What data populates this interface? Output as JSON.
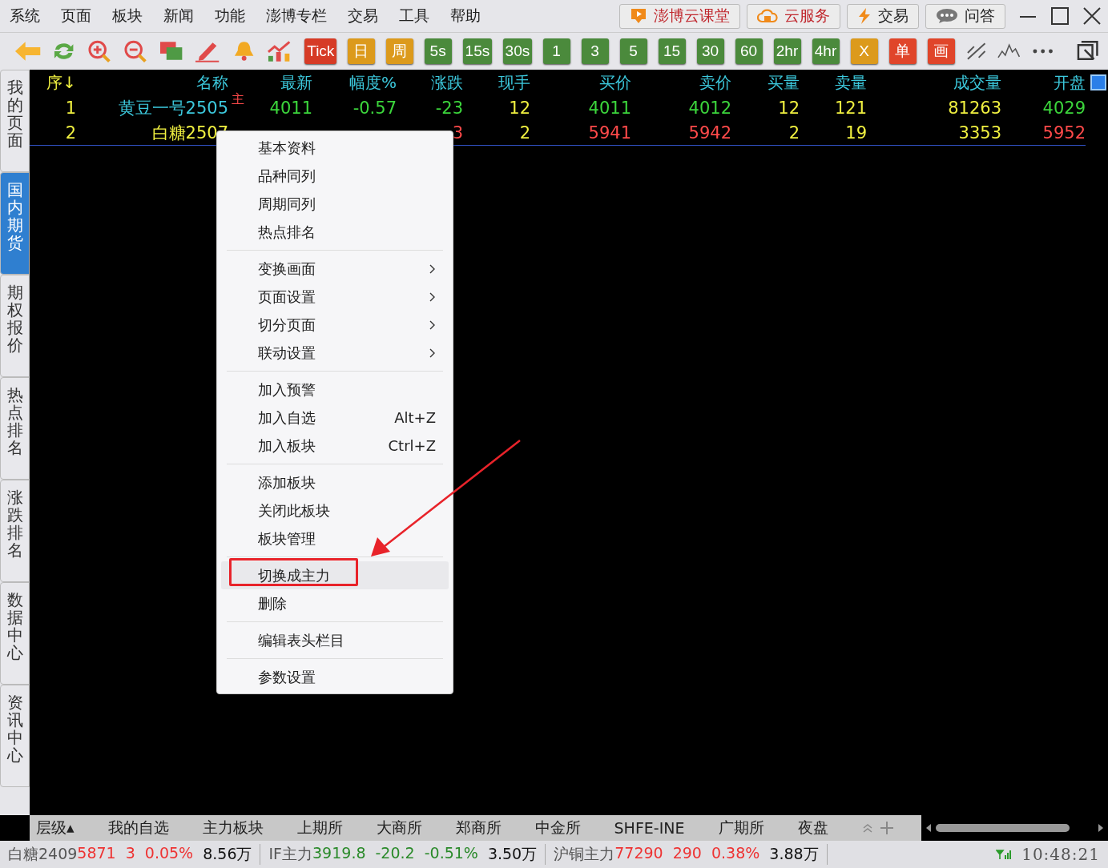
{
  "menubar": [
    "系统",
    "页面",
    "板块",
    "新闻",
    "功能",
    "澎博专栏",
    "交易",
    "工具",
    "帮助"
  ],
  "top_buttons": [
    {
      "label": "澎博云课堂",
      "kind": "course"
    },
    {
      "label": "云服务",
      "kind": "cloud"
    },
    {
      "label": "交易",
      "kind": "trade"
    },
    {
      "label": "问答",
      "kind": "chat"
    }
  ],
  "period_buttons": [
    {
      "label": "Tick",
      "color": "#d63b26"
    },
    {
      "label": "日",
      "color": "#dc9a1c"
    },
    {
      "label": "周",
      "color": "#dc9a1c"
    },
    {
      "label": "5s",
      "color": "#4b8a3c"
    },
    {
      "label": "15s",
      "color": "#4b8a3c"
    },
    {
      "label": "30s",
      "color": "#4b8a3c"
    },
    {
      "label": "1",
      "color": "#4b8a3c"
    },
    {
      "label": "3",
      "color": "#4b8a3c"
    },
    {
      "label": "5",
      "color": "#4b8a3c"
    },
    {
      "label": "15",
      "color": "#4b8a3c"
    },
    {
      "label": "30",
      "color": "#4b8a3c"
    },
    {
      "label": "60",
      "color": "#4b8a3c"
    },
    {
      "label": "2hr",
      "color": "#4b8a3c"
    },
    {
      "label": "4hr",
      "color": "#4b8a3c"
    },
    {
      "label": "X",
      "color": "#dc9a1c"
    },
    {
      "label": "单",
      "color": "#e0452a"
    },
    {
      "label": "画",
      "color": "#e0452a"
    }
  ],
  "sidebar": [
    {
      "label": "我的页面",
      "selected": false
    },
    {
      "label": "国内期货",
      "selected": true
    },
    {
      "label": "期权报价",
      "selected": false
    },
    {
      "label": "热点排名",
      "selected": false
    },
    {
      "label": "涨跌排名",
      "selected": false
    },
    {
      "label": "数据中心",
      "selected": false
    },
    {
      "label": "资讯中心",
      "selected": false
    }
  ],
  "table": {
    "columns": [
      {
        "label": "序↓",
        "kind": "index"
      },
      {
        "label": "名称",
        "kind": "name"
      },
      {
        "label": "最新",
        "kind": "price"
      },
      {
        "label": "幅度%",
        "kind": "price"
      },
      {
        "label": "涨跌",
        "kind": "price"
      },
      {
        "label": "现手",
        "kind": "volume"
      },
      {
        "label": "买价",
        "kind": "price"
      },
      {
        "label": "卖价",
        "kind": "price"
      },
      {
        "label": "买量",
        "kind": "volume"
      },
      {
        "label": "卖量",
        "kind": "volume"
      },
      {
        "label": "成交量",
        "kind": "volume"
      },
      {
        "label": "开盘",
        "kind": "price"
      }
    ],
    "settings_checked": true,
    "rows": [
      {
        "color": "#3cd63c",
        "tag": "主",
        "cells": [
          "1",
          {
            "text": "黄豆一号2505",
            "color": "#3cc8dc"
          },
          "4011",
          "-0.57",
          "-23",
          "12",
          "4011",
          "4012",
          "12",
          "121",
          "81263",
          "4029"
        ]
      },
      {
        "color": "#ff4a4a",
        "cells": [
          "2",
          {
            "text": "白糖2507",
            "color": "#f0f040"
          },
          null,
          null,
          "3",
          "2",
          "5941",
          "5942",
          "2",
          "19",
          "3353",
          "5952"
        ]
      }
    ]
  },
  "context_menu": [
    [
      {
        "label": "基本资料"
      },
      {
        "label": "品种同列"
      },
      {
        "label": "周期同列"
      },
      {
        "label": "热点排名"
      }
    ],
    [
      {
        "label": "变换画面",
        "submenu": true
      },
      {
        "label": "页面设置",
        "submenu": true
      },
      {
        "label": "切分页面",
        "submenu": true
      },
      {
        "label": "联动设置",
        "submenu": true
      }
    ],
    [
      {
        "label": "加入预警"
      },
      {
        "label": "加入自选",
        "shortcut": "Alt+Z"
      },
      {
        "label": "加入板块",
        "shortcut": "Ctrl+Z"
      }
    ],
    [
      {
        "label": "添加板块"
      },
      {
        "label": "关闭此板块"
      },
      {
        "label": "板块管理"
      }
    ],
    [
      {
        "label": "切换成主力",
        "selected": true
      },
      {
        "label": "删除",
        "selected": false
      }
    ],
    [
      {
        "label": "编辑表头栏目"
      }
    ],
    [
      {
        "label": "参数设置"
      }
    ]
  ],
  "bottom_tabs": [
    "层级▴",
    "我的自选",
    "主力板块",
    "上期所",
    "大商所",
    "郑商所",
    "中金所",
    "SHFE-INE",
    "广期所",
    "夜盘"
  ],
  "status_bar": {
    "tickers": [
      {
        "name": "白糖2409",
        "price": "5871",
        "change": "3",
        "pct": "0.05%",
        "volume": "8.56万",
        "color": "#ee3333"
      },
      {
        "name": "IF主力",
        "price": "3919.8",
        "change": "-20.2",
        "pct": "-0.51%",
        "volume": "3.50万",
        "color": "#2a8a2a"
      },
      {
        "name": "沪铜主力",
        "price": "77290",
        "change": "290",
        "pct": "0.38%",
        "volume": "3.88万",
        "color": "#ee3333"
      }
    ],
    "time": "10:48:21"
  }
}
